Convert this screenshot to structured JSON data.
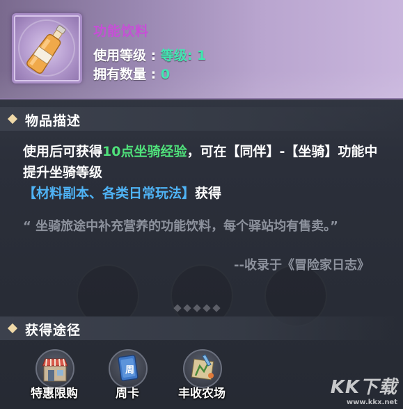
{
  "item": {
    "name": "功能饮料",
    "icon": "bottle-icon",
    "level_label": "使用等级 : ",
    "level_value": "等级: 1",
    "quantity_label": "拥有数量 : ",
    "quantity_value": "0"
  },
  "description_section": {
    "title": "物品描述",
    "line1_a": "使用后可获得",
    "line1_highlight": "10点坐骑经验",
    "line1_b": "，可在【同伴】-【坐骑】功能中提升坐骑等级",
    "line2_blue": "【材料副本、各类日常玩法】",
    "line2_b": "获得",
    "flavor": "“ 坐骑旅途中补充营养的功能饮料，每个驿站均有售卖。”",
    "source": "--收录于《冒险家日志》"
  },
  "acquire_section": {
    "title": "获得途径",
    "items": [
      {
        "label": "特惠限购",
        "icon": "shop-icon"
      },
      {
        "label": "周卡",
        "icon": "weekly-card-icon"
      },
      {
        "label": "丰收农场",
        "icon": "farm-icon"
      }
    ]
  },
  "watermark": {
    "main": "KK下载",
    "url": "www.kkx.net"
  },
  "colors": {
    "item_name": "#c64fd6",
    "value_green": "#42e6b0",
    "highlight_green": "#4fe07a",
    "link_blue": "#4fb3f5",
    "flavor_gray": "#8d929d"
  }
}
